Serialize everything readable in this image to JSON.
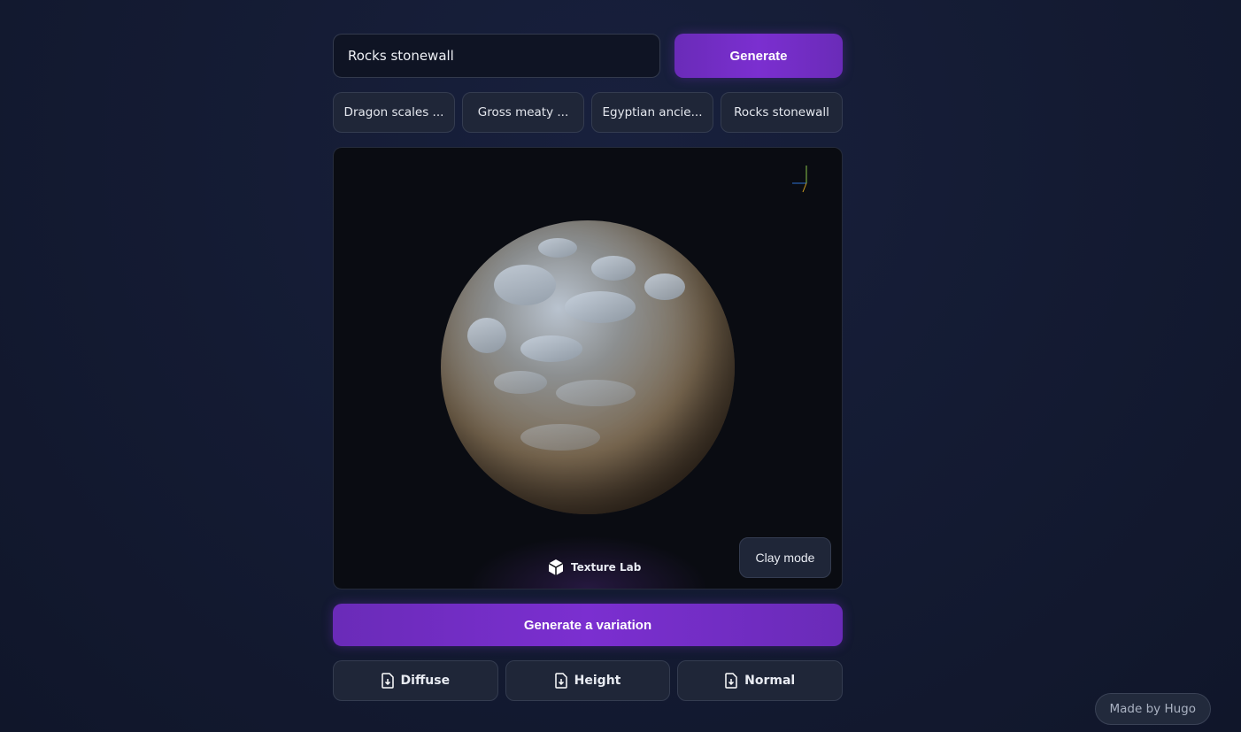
{
  "prompt": {
    "value": "Rocks stonewall",
    "generate_label": "Generate"
  },
  "suggestions": [
    "Dragon scales ...",
    "Gross meaty ...",
    "Egyptian ancie...",
    "Rocks stonewall"
  ],
  "viewer": {
    "brand": "Texture Lab",
    "clay_mode_label": "Clay mode"
  },
  "variation_label": "Generate a variation",
  "downloads": [
    "Diffuse",
    "Height",
    "Normal"
  ],
  "footer": {
    "made_by": "Made by Hugo"
  },
  "colors": {
    "accent": "#7b2fd0",
    "background": "#141b33"
  }
}
